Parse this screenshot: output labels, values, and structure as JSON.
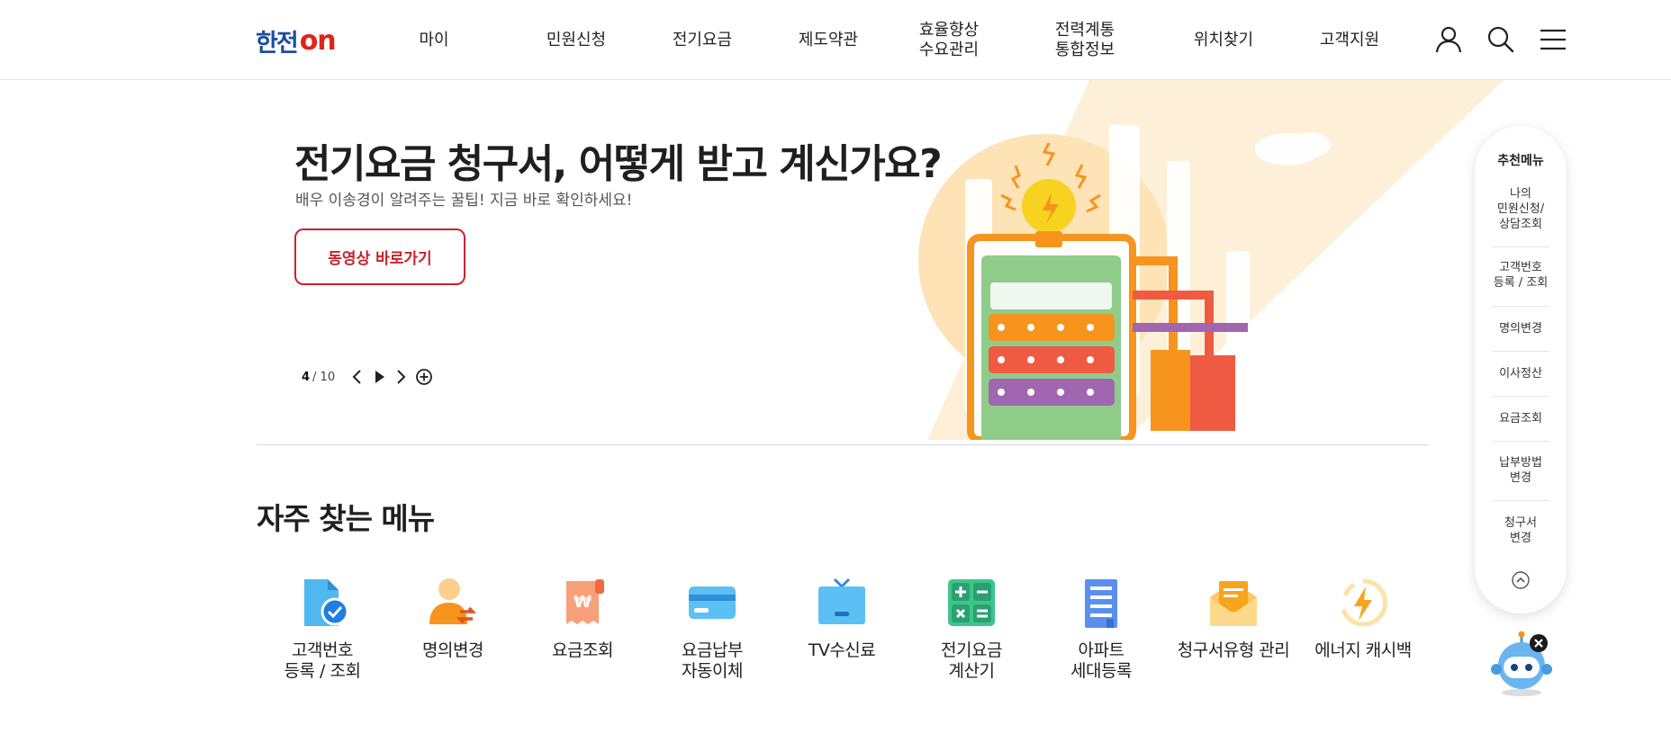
{
  "header": {
    "logo_korean": "한전",
    "logo_on": "on",
    "nav": [
      {
        "label": "마이"
      },
      {
        "label": "민원신청"
      },
      {
        "label": "전기요금"
      },
      {
        "label": "제도약관"
      },
      {
        "label": "효율향상\n수요관리"
      },
      {
        "label": "전력계통\n통합정보"
      },
      {
        "label": "위치찾기"
      },
      {
        "label": "고객지원"
      }
    ],
    "icons": [
      "user-icon",
      "search-icon",
      "menu-icon"
    ]
  },
  "hero": {
    "title": "전기요금 청구서, 어떻게 받고 계신가요?",
    "subtitle": "배우 이송경이 알려주는 꿀팁! 지금 바로 확인하세요!",
    "button_label": "동영상 바로가기",
    "pager_current": "4",
    "pager_total": "/ 10",
    "controls": [
      "prev-icon",
      "play-icon",
      "next-icon",
      "add-circle-icon"
    ]
  },
  "frequent_menu": {
    "title": "자주 찾는 메뉴",
    "items": [
      {
        "label": "고객번호\n등록 / 조회",
        "icon": "document-check-icon"
      },
      {
        "label": "명의변경",
        "icon": "person-change-icon"
      },
      {
        "label": "요금조회",
        "icon": "bill-won-icon"
      },
      {
        "label": "요금납부\n자동이체",
        "icon": "credit-card-icon"
      },
      {
        "label": "TV수신료",
        "icon": "tv-icon"
      },
      {
        "label": "전기요금\n계산기",
        "icon": "calculator-icon"
      },
      {
        "label": "아파트\n세대등록",
        "icon": "apartment-icon"
      },
      {
        "label": "청구서유형 관리",
        "icon": "envelope-icon"
      },
      {
        "label": "에너지 캐시백",
        "icon": "energy-bolt-icon"
      }
    ]
  },
  "quick_menu": {
    "title": "추천메뉴",
    "items": [
      {
        "label": "나의\n민원신청/\n상담조회"
      },
      {
        "label": "고객번호\n등록 / 조회"
      },
      {
        "label": "명의변경"
      },
      {
        "label": "이사정산"
      },
      {
        "label": "요금조회"
      },
      {
        "label": "납부방법\n변경"
      },
      {
        "label": "청구서\n변경"
      }
    ],
    "top_icon": "chevron-up-circle-icon"
  },
  "chatbot": {
    "icon": "chatbot-robot-icon",
    "close_icon": "close-icon"
  },
  "colors": {
    "brand_blue": "#1a4fa0",
    "brand_red": "#c8232b",
    "accent_orange": "#f7941d"
  }
}
